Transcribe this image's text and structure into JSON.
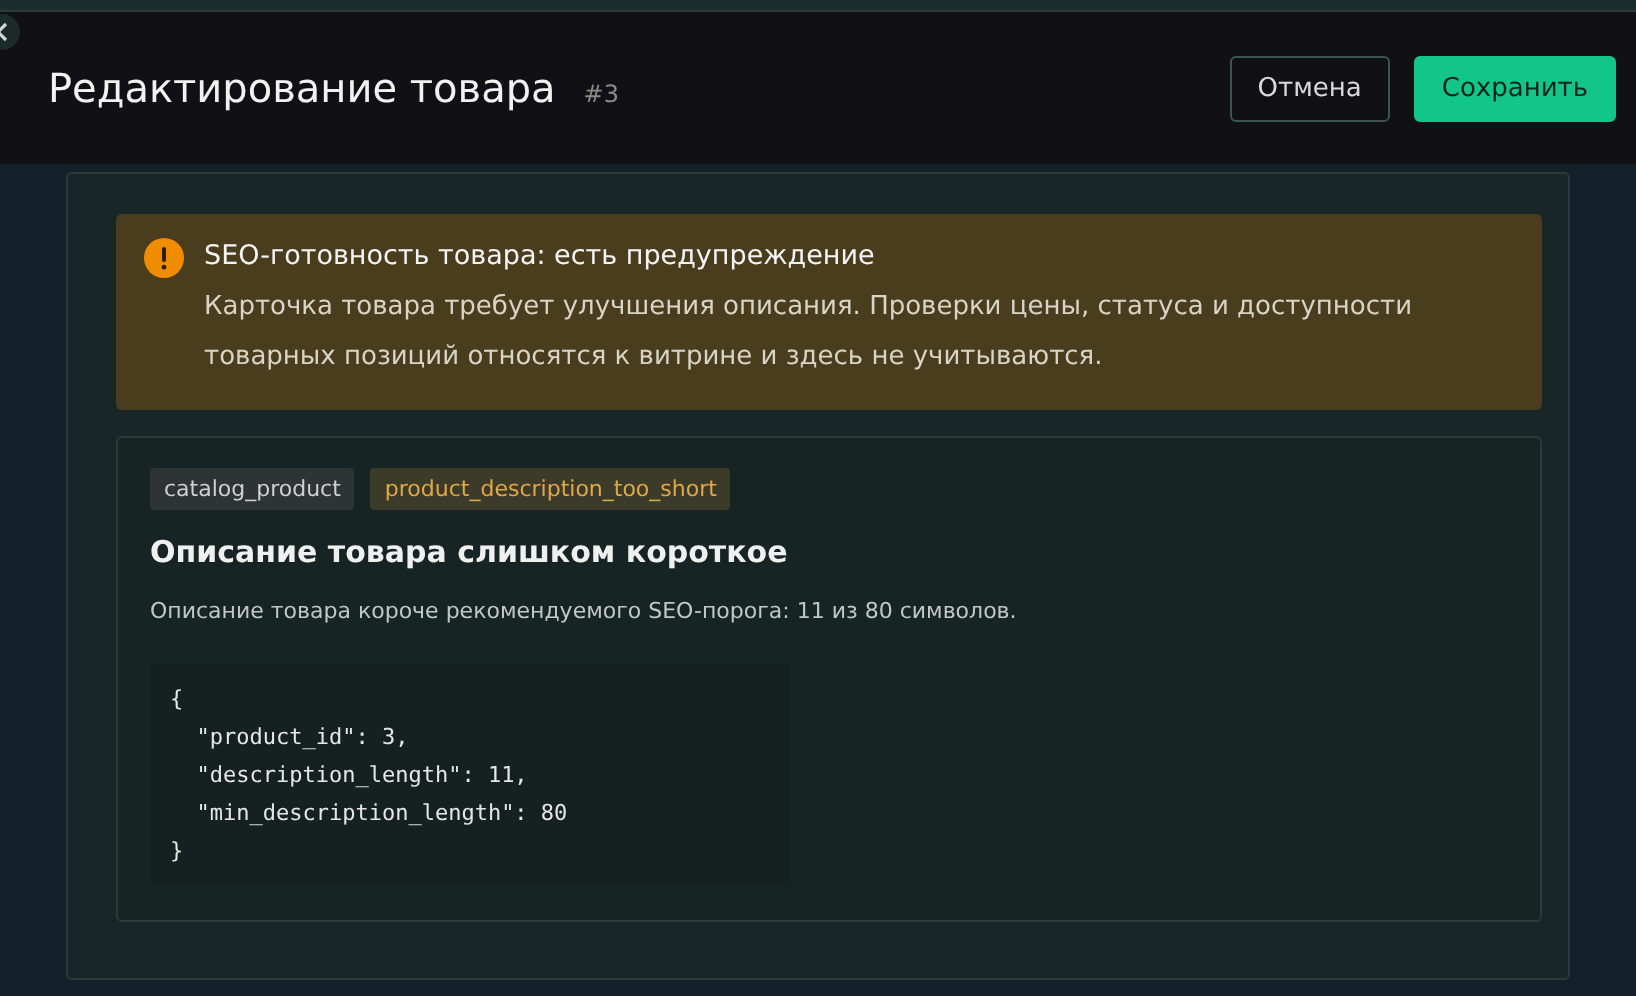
{
  "header": {
    "title": "Редактирование товара",
    "id_label": "#3",
    "buttons": [
      {
        "label": "Отмена",
        "kind": "secondary"
      },
      {
        "label": "Сохранить",
        "kind": "primary"
      }
    ]
  },
  "alert": {
    "kind": "warning",
    "title": "SEO-готовность товара: есть предупреждение",
    "message": "Карточка товара требует улучшения описания. Проверки цены, статуса и доступности товарных позиций относятся к витрине и здесь не учитываются."
  },
  "issue": {
    "tags": [
      {
        "label": "catalog_product",
        "kind": "entity"
      },
      {
        "label": "product_description_too_short",
        "kind": "rule"
      }
    ],
    "title": "Описание товара слишком короткое",
    "description": "Описание товара короче рекомендуемого SEO-порога: 11 из 80 символов.",
    "details": "{\n  \"product_id\": 3,\n  \"description_length\": 11,\n  \"min_description_length\": 80\n}"
  }
}
